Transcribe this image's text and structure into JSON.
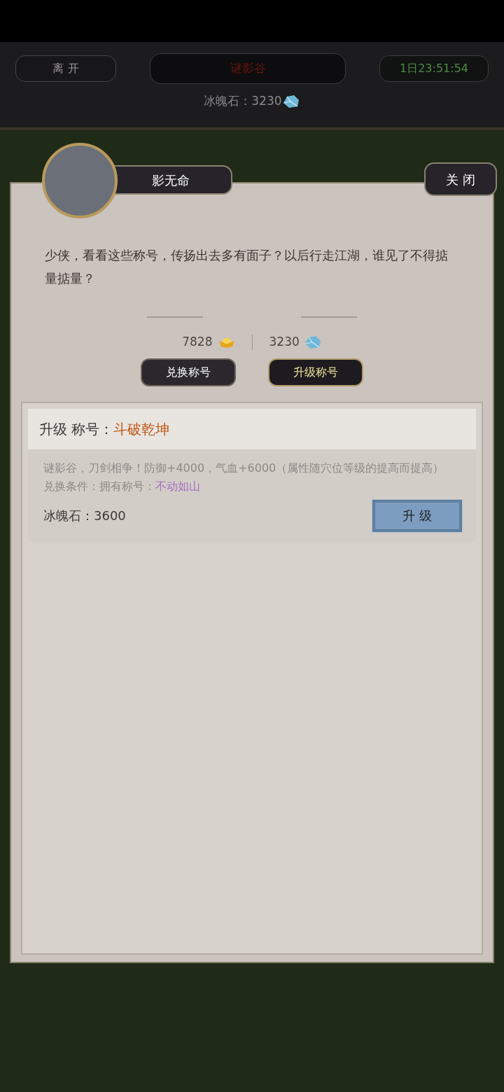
{
  "top_bar": {
    "leave_button": "离 开",
    "location": "谜影谷",
    "timer": "1日23:51:54",
    "resource_label": "冰魄石：",
    "resource_value": "3230"
  },
  "dialog": {
    "npc_name": "影无命",
    "close_button": "关 闭",
    "message": "少侠，看看这些称号，传扬出去多有面子？以后行走江湖，谁见了不得掂量掂量？"
  },
  "currencies": {
    "gold": "7828",
    "ice_stone": "3230"
  },
  "tabs": [
    {
      "label": "兑换称号",
      "selected": false
    },
    {
      "label": "升级称号",
      "selected": true
    }
  ],
  "upgrade_card": {
    "heading": "升级 称号：",
    "title_name": "斗破乾坤",
    "description": "谜影谷，刀剑相争！防御+4000，气血+6000（属性随穴位等级的提高而提高）",
    "condition_label": "兑换条件：拥有称号：",
    "condition_value": "不动如山",
    "cost": "冰魄石：3600",
    "button": "升 级"
  }
}
